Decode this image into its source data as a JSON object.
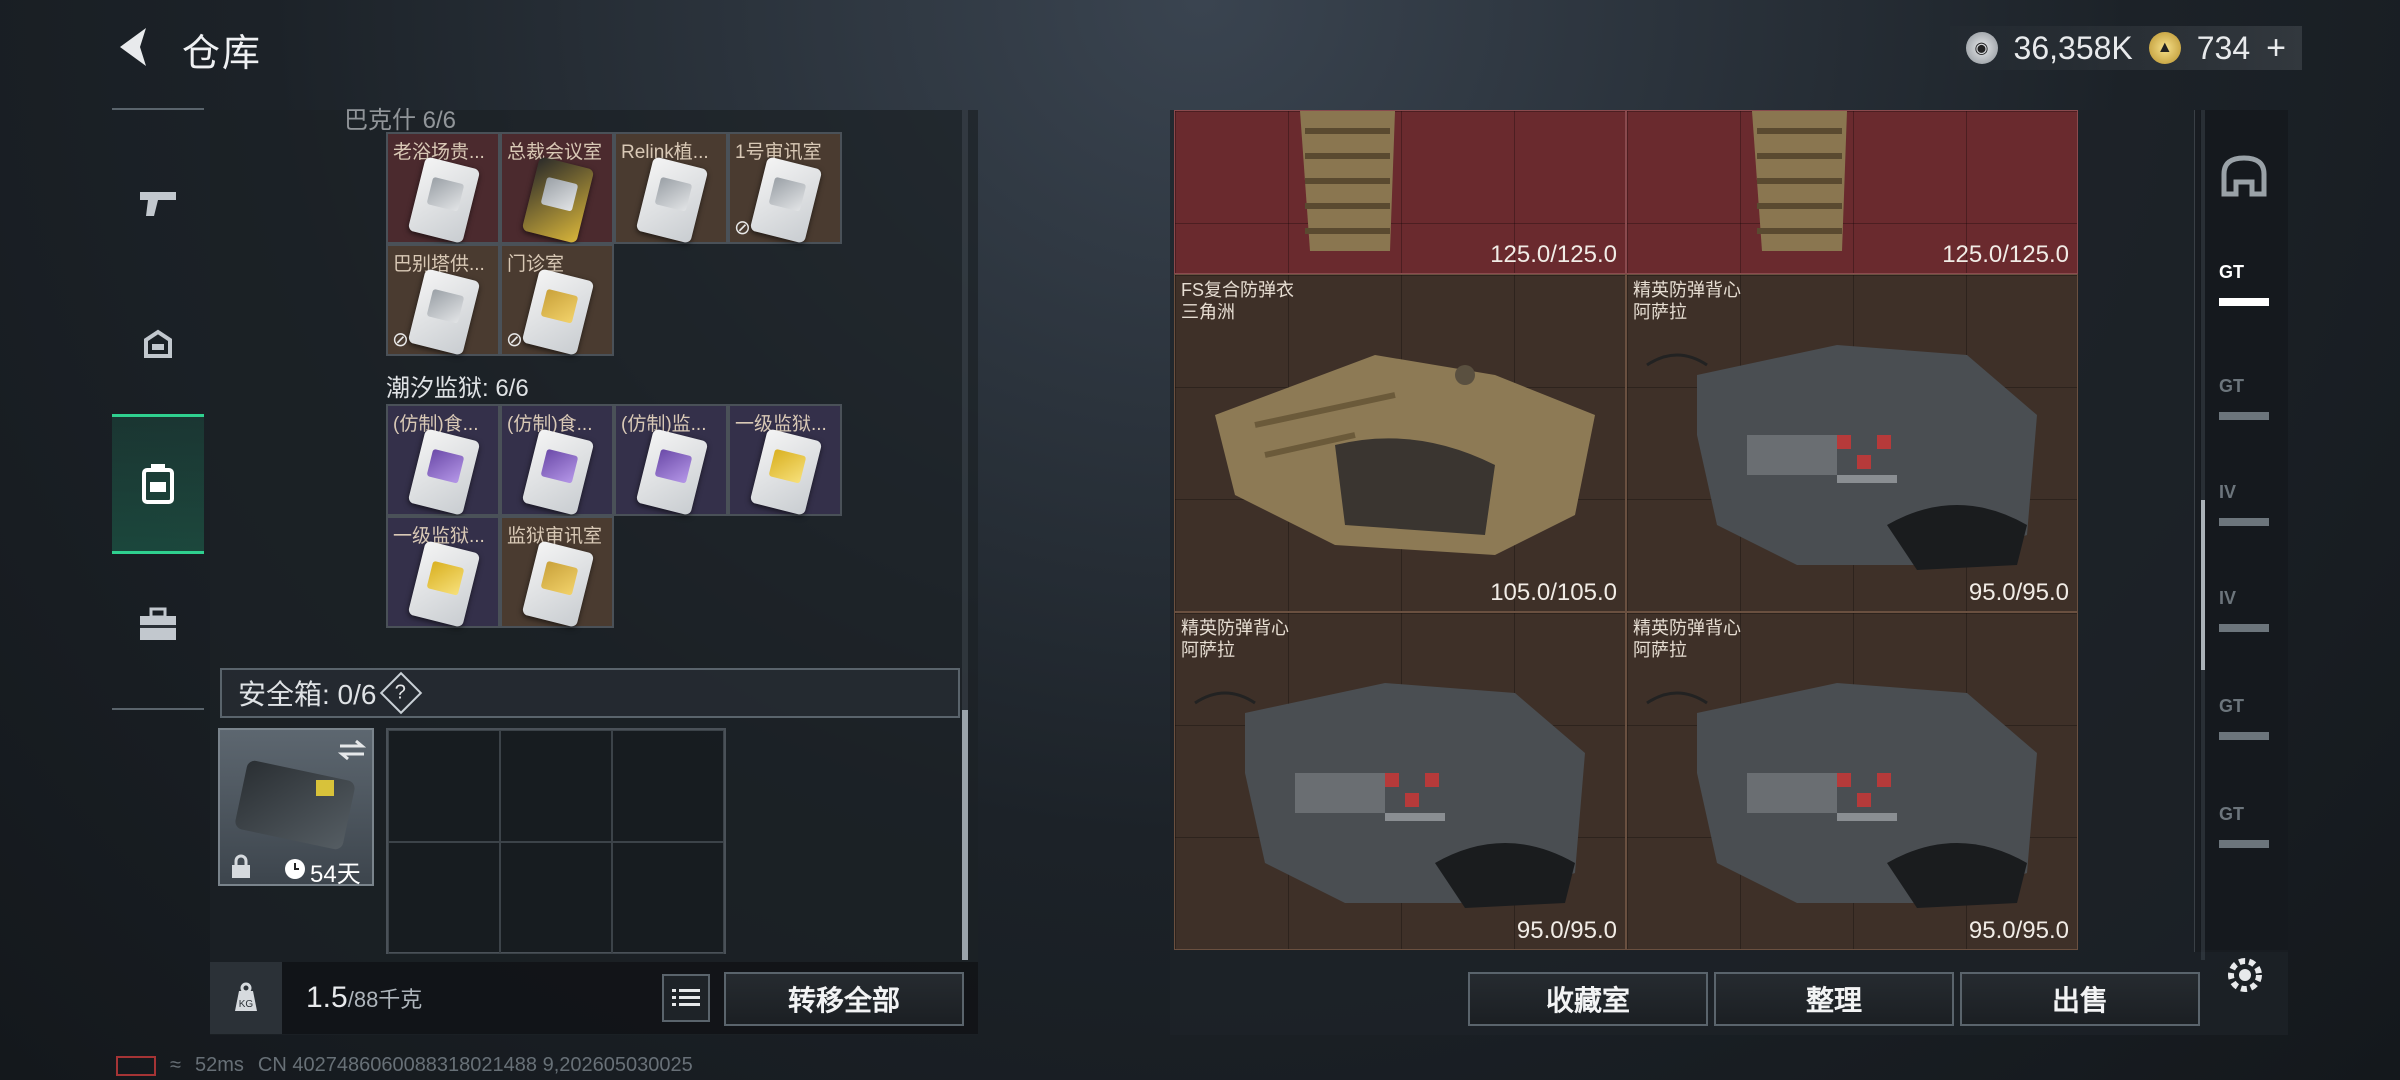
{
  "header": {
    "title": "仓库",
    "currencies": [
      {
        "icon": "silver-coin-icon",
        "value": "36,358K"
      },
      {
        "icon": "gold-coin-icon",
        "value": "734"
      }
    ],
    "add_symbol": "+"
  },
  "left_nav": {
    "items": [
      {
        "icon": "pistol-icon",
        "active": false
      },
      {
        "icon": "helmet-icon",
        "active": false
      },
      {
        "icon": "backpack-icon",
        "active": true
      },
      {
        "icon": "toolbox-icon",
        "active": false
      }
    ]
  },
  "keycards": {
    "section_partial_title": "巴克什  6/6",
    "group1": [
      {
        "label": "老浴场贵...",
        "color": "red",
        "card": "silver",
        "no_sell": false
      },
      {
        "label": "总裁会议室",
        "color": "red",
        "card": "black",
        "no_sell": false
      },
      {
        "label": "Relink植...",
        "color": "brown",
        "card": "silver",
        "no_sell": false
      },
      {
        "label": "1号审讯室",
        "color": "brown",
        "card": "silver",
        "no_sell": true
      },
      {
        "label": "巴别塔供...",
        "color": "brown",
        "card": "silver",
        "no_sell": true
      },
      {
        "label": "门诊室",
        "color": "brown",
        "card": "gold",
        "no_sell": true
      }
    ],
    "section2_title": "潮汐监狱: 6/6",
    "group2": [
      {
        "label": "(仿制)食...",
        "color": "purple",
        "card": "purple",
        "no_sell": false
      },
      {
        "label": "(仿制)食...",
        "color": "purple",
        "card": "purple",
        "no_sell": false
      },
      {
        "label": "(仿制)监...",
        "color": "purple",
        "card": "purple",
        "no_sell": false
      },
      {
        "label": "一级监狱...",
        "color": "purple",
        "card": "yellow",
        "no_sell": false
      },
      {
        "label": "一级监狱...",
        "color": "purple",
        "card": "yellow",
        "no_sell": false
      },
      {
        "label": "监狱审讯室",
        "color": "brown",
        "card": "gold",
        "no_sell": false
      }
    ]
  },
  "safe_box": {
    "label": "安全箱: 0/6",
    "help": "?",
    "case_days": "54天",
    "swap_icon": "swap-icon"
  },
  "footer_left": {
    "weight_current": "1.5",
    "weight_max": "/88千克",
    "transfer_all": "转移全部"
  },
  "right_items": [
    {
      "name_line1": "",
      "name_line2": "",
      "durability": "125.0/125.0",
      "style": "red",
      "type": "vest-tan-partial"
    },
    {
      "name_line1": "",
      "name_line2": "",
      "durability": "125.0/125.0",
      "style": "red",
      "type": "vest-tan-partial"
    },
    {
      "name_line1": "FS复合防弹衣",
      "name_line2": "三角洲",
      "durability": "105.0/105.0",
      "style": "brown",
      "type": "vest-tan"
    },
    {
      "name_line1": "精英防弹背心",
      "name_line2": "阿萨拉",
      "durability": "95.0/95.0",
      "style": "brown",
      "type": "vest-dark"
    },
    {
      "name_line1": "精英防弹背心",
      "name_line2": "阿萨拉",
      "durability": "95.0/95.0",
      "style": "brown",
      "type": "vest-dark"
    },
    {
      "name_line1": "精英防弹背心",
      "name_line2": "阿萨拉",
      "durability": "95.0/95.0",
      "style": "brown",
      "type": "vest-dark"
    }
  ],
  "right_buttons": {
    "collection": "收藏室",
    "sort": "整理",
    "sell": "出售"
  },
  "right_nav": {
    "items": [
      {
        "icon": "helmet-icon",
        "label": "",
        "active": false
      },
      {
        "icon": "armor-tier-icon",
        "label": "GT",
        "active": true
      },
      {
        "icon": "armor-tier-icon",
        "label": "GT",
        "active": false
      },
      {
        "icon": "armor-tier-icon",
        "label": "IV",
        "active": false
      },
      {
        "icon": "armor-tier-icon",
        "label": "IV",
        "active": false
      },
      {
        "icon": "armor-tier-icon",
        "label": "GT",
        "active": false
      },
      {
        "icon": "armor-tier-icon",
        "label": "GT",
        "active": false
      }
    ]
  },
  "status_bar": {
    "ping": "52ms",
    "info": "CN 4027486060088318021488 9,202605030025"
  },
  "colors": {
    "accent_green": "#2fd08f",
    "slot_red": "#4b2a2e",
    "slot_brown": "#4a3b30",
    "slot_purple": "#34304a",
    "item_red": "#6a2a2e",
    "item_brown": "#3e3028"
  }
}
